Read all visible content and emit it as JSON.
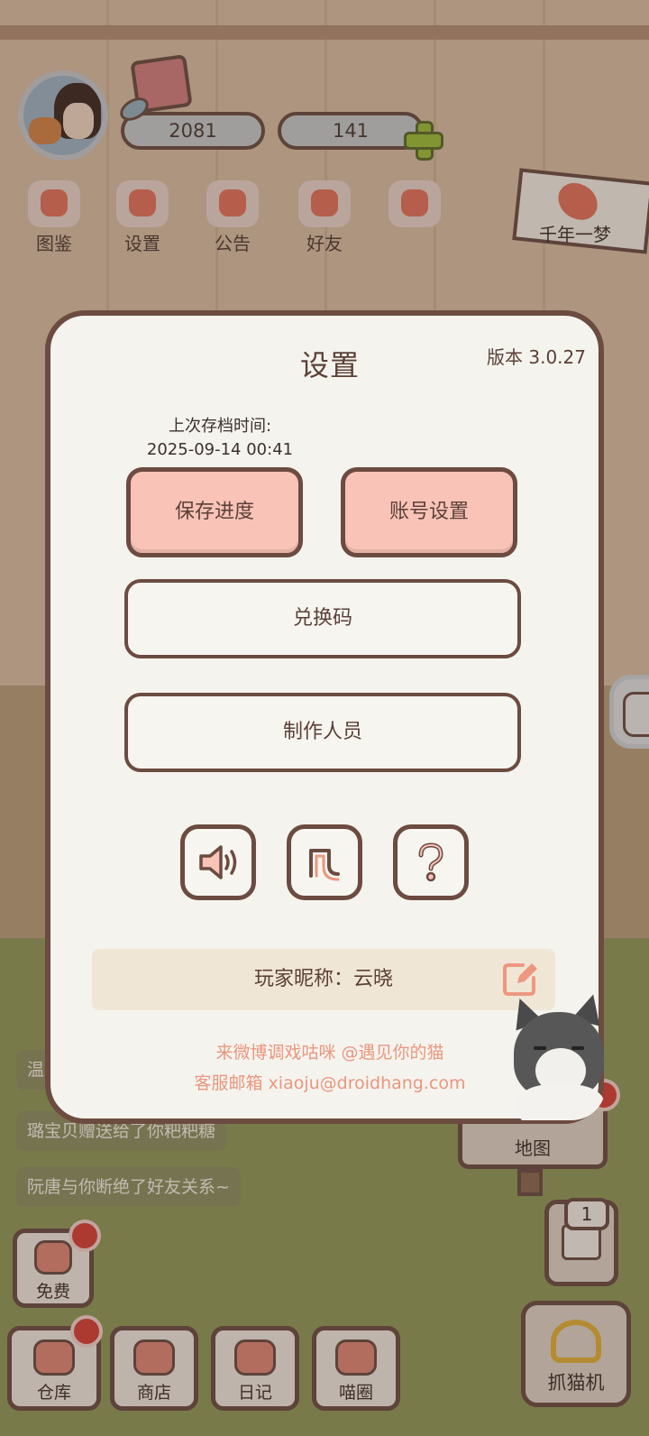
{
  "hud": {
    "coins": "2081",
    "gems": "141"
  },
  "nav": [
    {
      "label": "图鉴",
      "icon": "cat-face-icon"
    },
    {
      "label": "设置",
      "icon": "gear-icon"
    },
    {
      "label": "公告",
      "icon": "gift-icon"
    },
    {
      "label": "好友",
      "icon": "friends-icon"
    },
    {
      "label": "",
      "icon": "heart-icon"
    }
  ],
  "poster": {
    "label": "千年一梦"
  },
  "chat": [
    {
      "text": "温"
    },
    {
      "text": "璐宝贝赠送给了你粑粑糖"
    },
    {
      "text": "阮唐与你断绝了好友关系~"
    }
  ],
  "toolbar": {
    "free": "免费",
    "warehouse": "仓库",
    "shop": "商店",
    "diary": "日记",
    "circle": "喵圈",
    "map": "地图",
    "claw": "抓猫机",
    "machine_count": "1"
  },
  "settings": {
    "title": "设置",
    "version": "版本 3.0.27",
    "last_save_label": "上次存档时间:",
    "last_save_time": "2025-09-14 00:41",
    "save_button": "保存进度",
    "account_button": "账号设置",
    "redeem_button": "兑换码",
    "credits_button": "制作人员",
    "nickname": "玩家昵称：云晓",
    "weibo": "来微博调戏咕咪 @遇见你的猫",
    "email": "客服邮箱 xiaoju@droidhang.com"
  },
  "colors": {
    "modal_bg": "#f5f3ee",
    "border": "#6c4b40",
    "pink_button": "#fac3b8",
    "accent_salmon": "#e9977f",
    "badge_red": "#d7423a"
  }
}
